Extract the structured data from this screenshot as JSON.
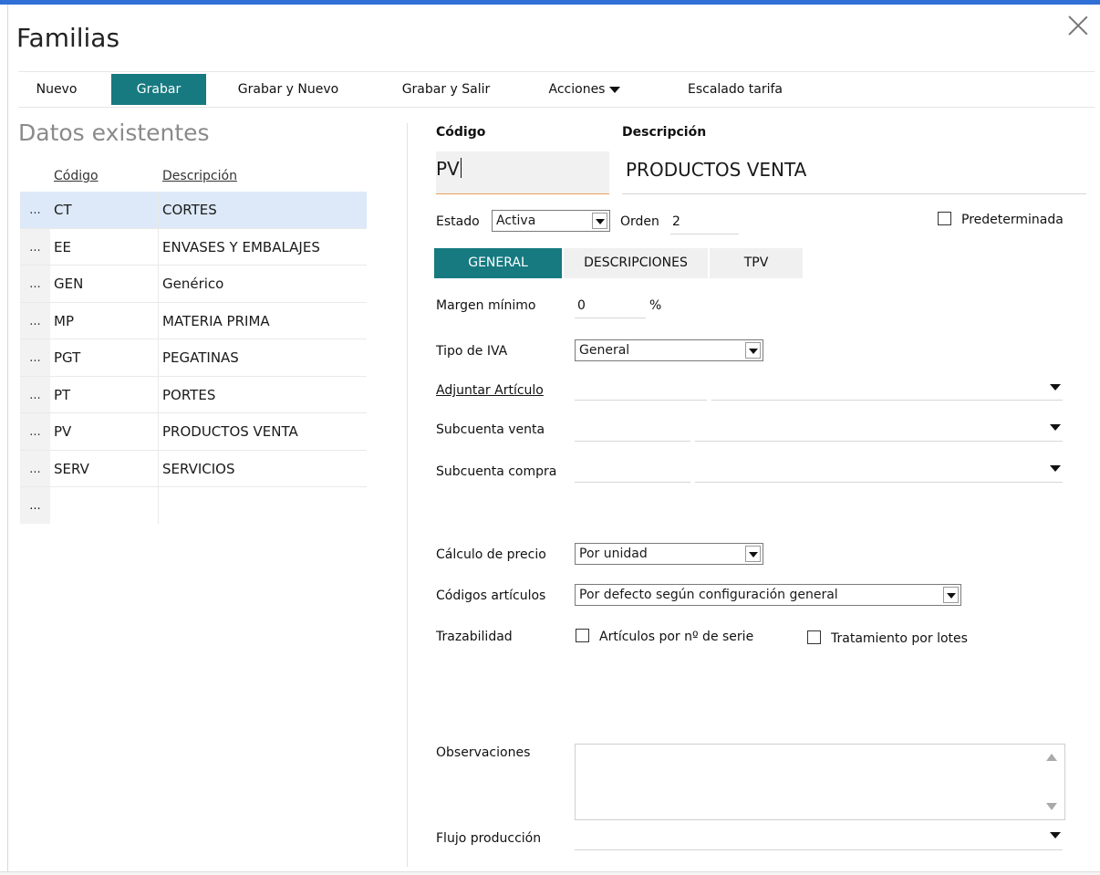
{
  "window": {
    "title": "Familias"
  },
  "toolbar": {
    "nuevo": "Nuevo",
    "grabar": "Grabar",
    "grabar_nuevo": "Grabar y Nuevo",
    "grabar_salir": "Grabar y Salir",
    "acciones": "Acciones",
    "escalado": "Escalado tarifa"
  },
  "list": {
    "title": "Datos existentes",
    "headers": {
      "codigo": "Código",
      "descripcion": "Descripción"
    },
    "rows": [
      {
        "dots": "...",
        "code": "CT",
        "desc": "CORTES"
      },
      {
        "dots": "...",
        "code": "EE",
        "desc": "ENVASES Y EMBALAJES"
      },
      {
        "dots": "...",
        "code": "GEN",
        "desc": "Genérico"
      },
      {
        "dots": "...",
        "code": "MP",
        "desc": "MATERIA PRIMA"
      },
      {
        "dots": "...",
        "code": "PGT",
        "desc": "PEGATINAS"
      },
      {
        "dots": "...",
        "code": "PT",
        "desc": "PORTES"
      },
      {
        "dots": "...",
        "code": "PV",
        "desc": "PRODUCTOS VENTA"
      },
      {
        "dots": "...",
        "code": "SERV",
        "desc": "SERVICIOS"
      }
    ],
    "empty_dots": "..."
  },
  "form": {
    "codigo_label": "Código",
    "codigo_value": "PV",
    "descripcion_label": "Descripción",
    "descripcion_value": "PRODUCTOS VENTA",
    "estado_label": "Estado",
    "estado_value": "Activa",
    "orden_label": "Orden",
    "orden_value": "2",
    "predeterminada_label": "Predeterminada",
    "tabs": {
      "general": "GENERAL",
      "descripciones": "DESCRIPCIONES",
      "tpv": "TPV"
    },
    "margen_label": "Margen mínimo",
    "margen_value": "0",
    "margen_unit": "%",
    "iva_label": "Tipo de IVA",
    "iva_value": "General",
    "adjuntar_label": "Adjuntar Artículo",
    "subventa_label": "Subcuenta venta",
    "subcompra_label": "Subcuenta compra",
    "calculo_label": "Cálculo de precio",
    "calculo_value": "Por unidad",
    "codart_label": "Códigos artículos",
    "codart_value": "Por defecto según configuración general",
    "traza_label": "Trazabilidad",
    "serie_label": "Artículos por nº de serie",
    "lotes_label": "Tratamiento por lotes",
    "obs_label": "Observaciones",
    "flujo_label": "Flujo producción"
  }
}
